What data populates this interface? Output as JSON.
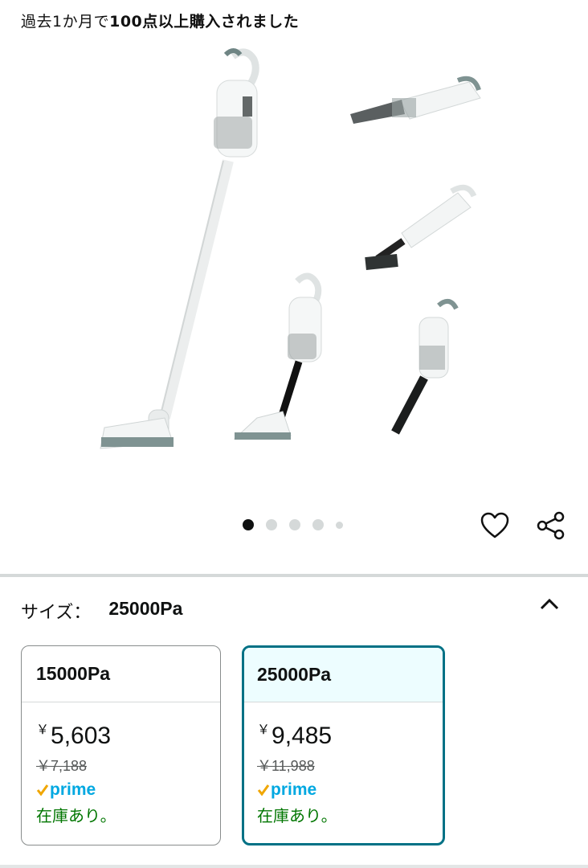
{
  "purchase_note": {
    "prefix": "過去1か月で",
    "bold": "100点以上購入されました"
  },
  "gallery": {
    "image_icon": "stick-vacuum-product-image",
    "dots_count": 5,
    "active_dot": 1
  },
  "actions": {
    "favorite_icon": "heart-icon",
    "share_icon": "share-icon"
  },
  "size_selector": {
    "label": "サイズ：",
    "selected_value": "25000Pa",
    "collapse_icon": "chevron-up-icon",
    "options": [
      {
        "name": "15000Pa",
        "yen": "￥",
        "price": "5,603",
        "list_price": "￥7,188",
        "prime": "prime",
        "stock": "在庫あり。",
        "selected": false
      },
      {
        "name": "25000Pa",
        "yen": "￥",
        "price": "9,485",
        "list_price": "￥11,988",
        "prime": "prime",
        "stock": "在庫あり。",
        "selected": true
      }
    ]
  },
  "colors": {
    "prime_blue": "#00a8e1",
    "prime_check": "#f0a600",
    "in_stock_green": "#007600",
    "selected_border": "#007185"
  }
}
